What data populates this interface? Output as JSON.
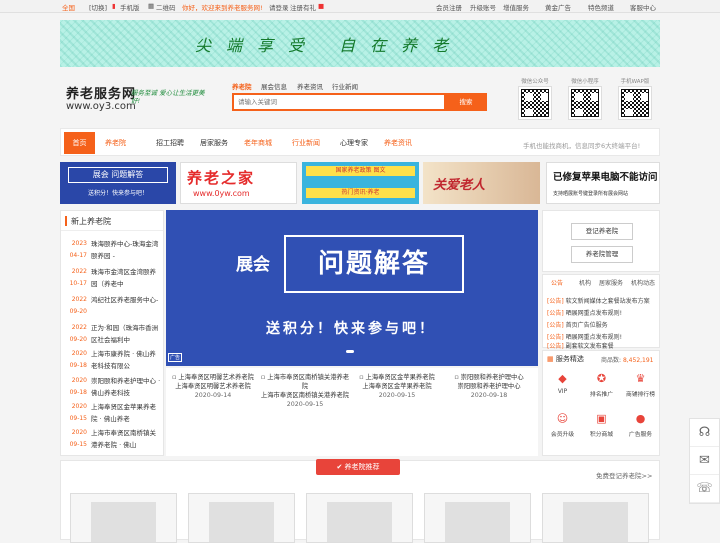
{
  "topbar": {
    "location": "全国",
    "switch": "[切换]",
    "mobile": "手机版",
    "qrcode": "二维码",
    "welcome": "你好，欢迎来到养老服务网!",
    "login": "请登录",
    "register": "注册有礼",
    "links": [
      "会员注册",
      "升级账号",
      "增值服务",
      "黄金广告",
      "特色频道",
      "客服中心"
    ]
  },
  "banner": {
    "text": "尖端享受 自在养老"
  },
  "brand": {
    "name": "养老服务网",
    "url": "www.oy3.com",
    "slogan": "服务至诚 爱心让生活更美好!"
  },
  "search": {
    "tabs": [
      "养老院",
      "展会信息",
      "养老资讯",
      "行业新闻"
    ],
    "placeholder": "请输入关键词",
    "button": "搜索"
  },
  "qr_codes": [
    "微信公众号",
    "微信小程序",
    "手机WAP版"
  ],
  "nav": {
    "items": [
      "首页",
      "养老院",
      "招工招聘",
      "居家服务",
      "老年商城",
      "行业新闻",
      "心理专家",
      "养老资讯"
    ],
    "tip": "手机也能找商机，信息同步6大终端平台!"
  },
  "ads": [
    {
      "line1": "展会 问题解答",
      "line2": "送积分！快来参与吧！"
    },
    {
      "line1": "养老之家",
      "line2": "www.0yw.com"
    },
    {
      "line1": "国家养老政策 图文",
      "line2": "热门资讯·养老"
    },
    {
      "line1": "关爱老人",
      "line2": ""
    },
    {
      "line1": "已修复苹果电脑不能访问",
      "line2": "支持晒展账号键登录所有展会网站"
    }
  ],
  "new_homes": {
    "title": "新上养老院",
    "items": [
      {
        "date": "2023 04-17",
        "text": "珠海颐养中心-珠海金湾颐养园 -"
      },
      {
        "date": "2022 10-17",
        "text": "珠海市金湾区金湾颐养园（养老中"
      },
      {
        "date": "2022 09-20",
        "text": "鸿纪社区养老服务中心-"
      },
      {
        "date": "2022 09-20",
        "text": "正为·和园（珠海市香洲区社会福利中"
      },
      {
        "date": "2020 09-18",
        "text": "上海市康养院 · 佛山养老科技有限公"
      },
      {
        "date": "2020 09-18",
        "text": "崇阳颐和养老护理中心 · 佛山养老科技"
      },
      {
        "date": "2020 09-15",
        "text": "上海奉贤区金苹果养老院 · 佛山养老"
      },
      {
        "date": "2020 09-15",
        "text": "上海市奉贤区南桥镇关港养老院 · 佛山"
      }
    ]
  },
  "slider": {
    "title1": "展会",
    "title2": "问题解答",
    "subtitle": "送积分！快来参与吧！",
    "tag": "广告"
  },
  "thumbs": [
    {
      "alt": "上海奉贤区明馨艺术养老院",
      "name": "上海奉贤区明馨艺术养老院",
      "date": "2020-09-14"
    },
    {
      "alt": "上海市奉贤区南桥镇关港养老院",
      "name": "上海市奉贤区南桥镇关港养老院",
      "date": "2020-09-15"
    },
    {
      "alt": "上海奉贤区金苹果养老院",
      "name": "上海奉贤区金苹果养老院",
      "date": "2020-09-15"
    },
    {
      "alt": "崇阳颐和养老护理中心",
      "name": "崇阳颐和养老护理中心",
      "date": "2020-09-18"
    }
  ],
  "right": {
    "btn1": "登记养老院",
    "btn2": "养老院管理",
    "tabs": [
      "公告",
      "机构",
      "居家服务",
      "机构动态"
    ],
    "notices": [
      {
        "tag": "[公告]",
        "text": "软文新闻媒体之套餐站发布方案"
      },
      {
        "tag": "[公告]",
        "text": "晒展网重点发布规则!"
      },
      {
        "tag": "[公告]",
        "text": "首页广告位服务"
      },
      {
        "tag": "[公告]",
        "text": "晒展网重点发布规则!"
      },
      {
        "tag": "[公告]",
        "text": "副套软文发布套餐"
      }
    ],
    "service_title": "服务精选",
    "count_label": "商品数:",
    "count": "8,452,191",
    "services": [
      "VIP",
      "排名推广",
      "商铺排行榜",
      "会员升级",
      "积分商城",
      "广告服务"
    ]
  },
  "recommend": {
    "title": "养老院推荐",
    "link": "免费登记养老院>>"
  }
}
